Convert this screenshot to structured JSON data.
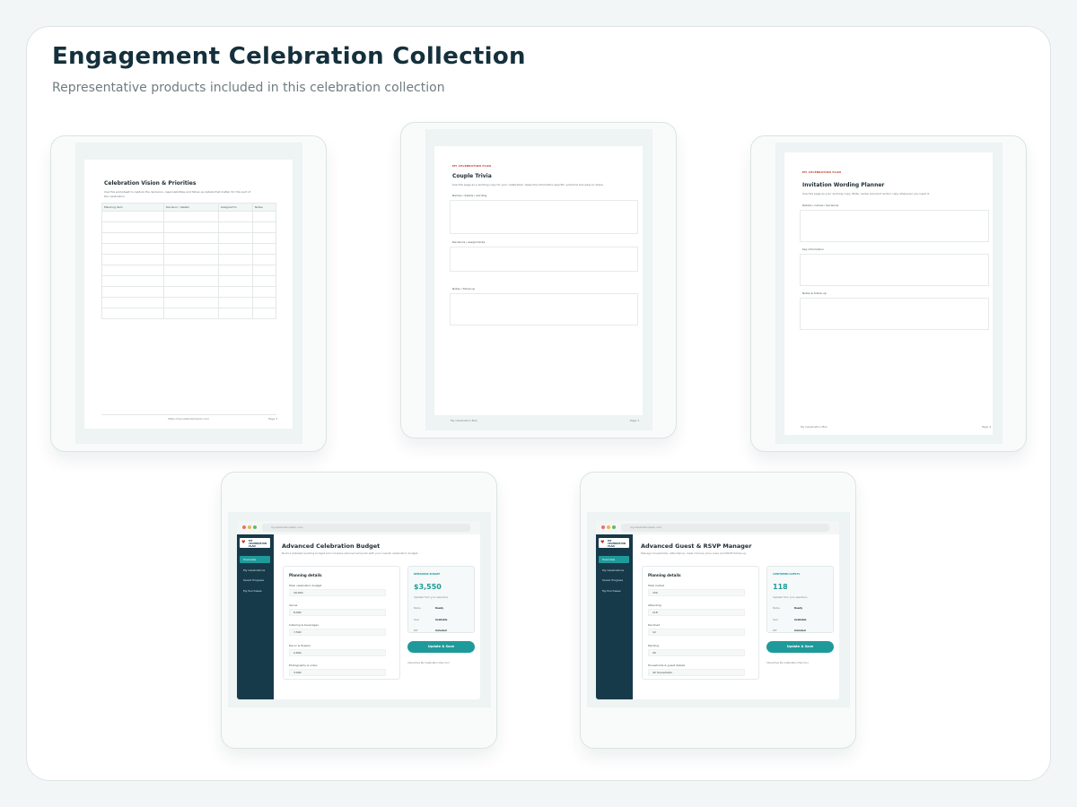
{
  "page": {
    "title": "Engagement Celebration Collection",
    "subtitle": "Representative products included in this celebration collection"
  },
  "colors": {
    "brand_teal": "#1f9a9a",
    "navy": "#173a4a",
    "accent_red": "#c0392b"
  },
  "doc1": {
    "title": "Celebration Vision & Priorities",
    "desc_line1": "Use this worksheet to capture the decisions, responsibilities and follow-up details that matter for this part of",
    "desc_line2": "the celebration.",
    "columns": [
      "Planning item",
      "Decision / details",
      "Assigned to",
      "Notes"
    ],
    "row_count": 10,
    "footer_url": "https://mycelebrationplan.com",
    "footer_page": "Page 2"
  },
  "doc2": {
    "eyebrow": "MY CELEBRATION PLAN",
    "title": "Couple Trivia",
    "desc": "Use this page as a working copy for your celebration. Keep the information specific, practical and easy to share.",
    "sections": [
      "Names / details / wording",
      "Decisions / assignments",
      "Notes / follow-up"
    ],
    "footer_left": "My Celebration Plan",
    "footer_page": "Page 3"
  },
  "doc3": {
    "eyebrow": "MY CELEBRATION PLAN",
    "title": "Invitation Wording Planner",
    "desc": "Use this page as your working copy. Write, revise and print and/or copy whenever you need it.",
    "sections": [
      "Details / names / decisions",
      "Key information",
      "Notes & follow-up"
    ],
    "footer_left": "My Celebration Plan",
    "footer_page": "Page 4"
  },
  "budget_app": {
    "url": "mycelebrationplan.com",
    "logo_line1": "MY",
    "logo_line2": "CELEBRATION",
    "logo_line3": "PLAN",
    "nav": [
      "Overview",
      "My Celebrations",
      "Saved Progress",
      "My Purchases"
    ],
    "title": "Advanced Celebration Budget",
    "subtitle": "Build a detailed working budget and compare planned amounts with your overall celebration budget.",
    "panel_title": "Planning details",
    "fields": [
      {
        "label": "Total celebration budget",
        "value": "18,000"
      },
      {
        "label": "Venue",
        "value": "8,000"
      },
      {
        "label": "Catering & beverages",
        "value": "7,500"
      },
      {
        "label": "Decor & flowers",
        "value": "2,600"
      },
      {
        "label": "Photography & video",
        "value": "3,000"
      }
    ],
    "summary_label": "REMAINING BUDGET",
    "summary_value": "$3,550",
    "summary_updated": "Updated from your selections",
    "summary_rows": [
      {
        "key": "Status",
        "value": "Ready"
      },
      {
        "key": "Save",
        "value": "Available"
      },
      {
        "key": "PDF",
        "value": "Included"
      }
    ],
    "button": "Update & Save",
    "note": "Interactive My Celebration Plan tool"
  },
  "guest_app": {
    "url": "mycelebrationplan.com",
    "logo_line1": "MY",
    "logo_line2": "CELEBRATION",
    "logo_line3": "PLAN",
    "nav": [
      "Overview",
      "My Celebrations",
      "Saved Progress",
      "My Purchases"
    ],
    "title": "Advanced Guest & RSVP Manager",
    "subtitle": "Manage households, attendance, meal choices, plus-ones and RSVP follow-up.",
    "panel_title": "Planning details",
    "fields": [
      {
        "label": "Total invited",
        "value": "150"
      },
      {
        "label": "Attending",
        "value": "118"
      },
      {
        "label": "Declined",
        "value": "12"
      },
      {
        "label": "Pending",
        "value": "20"
      },
      {
        "label": "Households & guest details",
        "value": "42 households"
      }
    ],
    "summary_label": "CONFIRMED GUESTS",
    "summary_value": "118",
    "summary_updated": "Updated from your selections",
    "summary_rows": [
      {
        "key": "Status",
        "value": "Ready"
      },
      {
        "key": "Save",
        "value": "Available"
      },
      {
        "key": "PDF",
        "value": "Included"
      }
    ],
    "button": "Update & Save",
    "note": "Interactive My Celebration Plan tool"
  }
}
